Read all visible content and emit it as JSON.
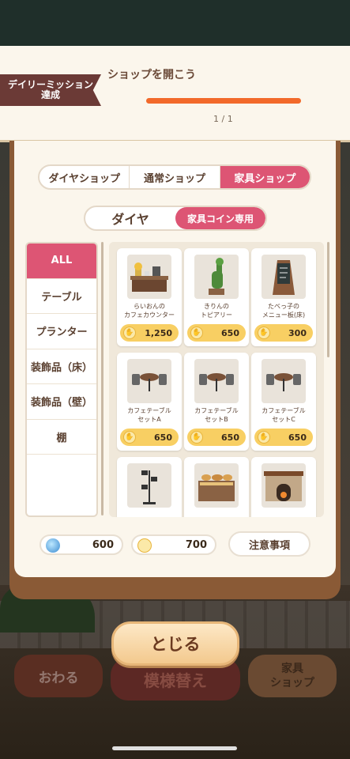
{
  "mission": {
    "ribbon_line1": "デイリーミッション",
    "ribbon_line2": "達成",
    "title": "ショップを開こう",
    "progress_text": "1 / 1",
    "progress_fraction": 1.0
  },
  "shop_tabs": [
    "ダイヤショップ",
    "通常ショップ",
    "家具ショップ"
  ],
  "active_shop_tab": "家具ショップ",
  "currency_tabs": [
    "ダイヤ",
    "家具コイン専用"
  ],
  "active_currency_tab": "家具コイン専用",
  "categories": [
    "ALL",
    "テーブル",
    "プランター",
    "装飾品（床）",
    "装飾品（壁）",
    "棚"
  ],
  "active_category": "ALL",
  "items": [
    {
      "name": "らいおんの\nカフェカウンター",
      "price": "1,250",
      "icon": "cafe-counter-icon"
    },
    {
      "name": "きりんの\nトピアリー",
      "price": "650",
      "icon": "giraffe-topiary-icon"
    },
    {
      "name": "たべっ子の\nメニュー板(床)",
      "price": "300",
      "icon": "menu-board-icon"
    },
    {
      "name": "カフェテーブル\nセットA",
      "price": "650",
      "icon": "cafe-table-set-icon"
    },
    {
      "name": "カフェテーブル\nセットB",
      "price": "650",
      "icon": "cafe-table-set-icon"
    },
    {
      "name": "カフェテーブル\nセットC",
      "price": "650",
      "icon": "cafe-table-set-icon"
    },
    {
      "name": "",
      "price": "",
      "icon": "floor-lamp-icon"
    },
    {
      "name": "",
      "price": "",
      "icon": "bread-shelf-icon"
    },
    {
      "name": "",
      "price": "",
      "icon": "fireplace-icon"
    }
  ],
  "currency": {
    "diamond": "600",
    "furniture_coin": "700",
    "notice_label": "注意事項"
  },
  "buttons": {
    "close": "とじる",
    "end": "おわる",
    "remodel": "模様替え",
    "furniture_shop": "家具\nショップ"
  },
  "colors": {
    "accent_pink": "#dd5574",
    "progress_orange": "#f2692a",
    "coin_yellow": "#f8cf63",
    "ribbon_brown": "#6b3a36"
  }
}
